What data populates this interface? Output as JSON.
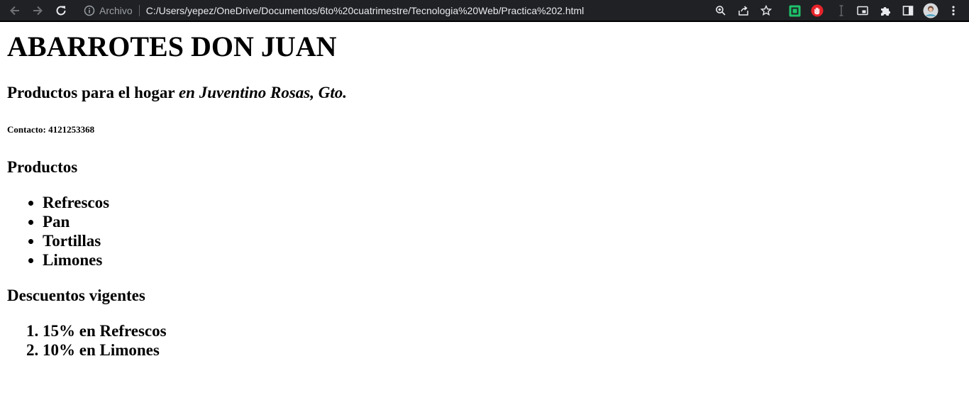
{
  "browser": {
    "site_info_label": "Archivo",
    "url": "C:/Users/yepez/OneDrive/Documentos/6to%20cuatrimestre/Tecnologia%20Web/Practica%202.html",
    "icons": [
      "back-arrow-icon",
      "forward-arrow-icon",
      "reload-icon",
      "info-icon",
      "zoom-icon",
      "share-icon",
      "star-icon",
      "extension-green-icon",
      "extension-red-hand-icon",
      "text-cursor-icon",
      "picture-in-picture-icon",
      "puzzle-icon",
      "side-panel-icon",
      "profile-avatar",
      "more-vert-icon"
    ]
  },
  "page": {
    "title": "ABARROTES DON JUAN",
    "subtitle_plain": "Productos para el hogar ",
    "subtitle_italic": "en Juventino Rosas, Gto.",
    "contact": "Contacto: 4121253368",
    "products": {
      "heading": "Productos",
      "items": [
        "Refrescos",
        "Pan",
        "Tortillas",
        "Limones"
      ]
    },
    "discounts": {
      "heading": "Descuentos vigentes",
      "items": [
        "15% en Refrescos",
        "10% en Limones"
      ]
    }
  }
}
